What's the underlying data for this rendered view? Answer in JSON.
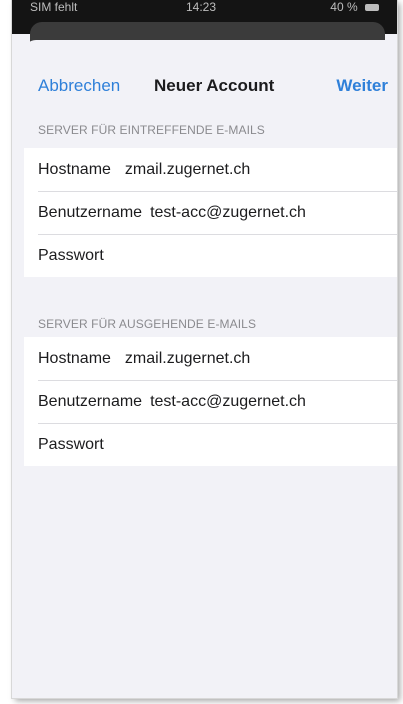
{
  "status_bar": {
    "carrier": "SIM fehlt",
    "time": "14:23",
    "battery": "40 %"
  },
  "navbar": {
    "cancel_label": "Abbrechen",
    "title": "Neuer Account",
    "next_label": "Weiter"
  },
  "incoming": {
    "header": "SERVER FÜR EINTREFFENDE E-MAILS",
    "hostname_label": "Hostname",
    "hostname_value": "zmail.zugernet.ch",
    "username_label": "Benutzername",
    "username_value": "test-acc@zugernet.ch",
    "password_label": "Passwort",
    "password_value": ""
  },
  "outgoing": {
    "header": "SERVER FÜR AUSGEHENDE E-MAILS",
    "hostname_label": "Hostname",
    "hostname_value": "zmail.zugernet.ch",
    "username_label": "Benutzername",
    "username_value": "test-acc@zugernet.ch",
    "password_label": "Passwort",
    "password_value": ""
  },
  "colors": {
    "accent": "#2f80d9",
    "background": "#f2f2f7",
    "cell": "#ffffff",
    "secondary_text": "#8a8a8e"
  }
}
